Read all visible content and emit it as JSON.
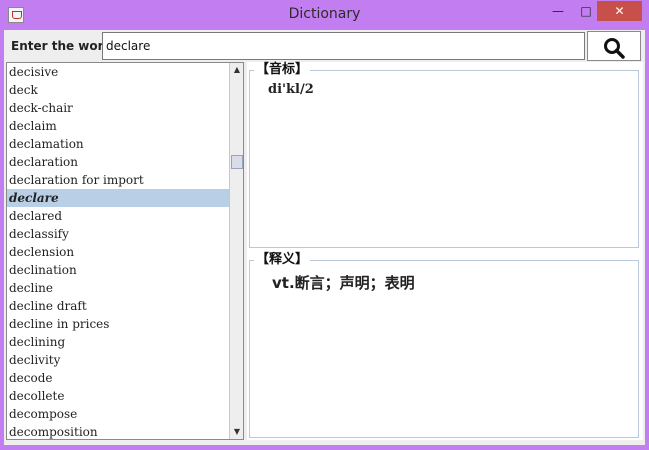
{
  "window": {
    "title": "Dictionary"
  },
  "titlebar": {
    "minimize": "—",
    "maximize": "□",
    "close": "✕"
  },
  "search": {
    "label": "Enter the word",
    "value": "declare"
  },
  "word_list": {
    "items": [
      "decisive",
      "deck",
      "deck-chair",
      "declaim",
      "declamation",
      "declaration",
      "declaration for import",
      "declare",
      "declared",
      "declassify",
      "declension",
      "declination",
      "decline",
      "decline draft",
      "decline in prices",
      "declining",
      "declivity",
      "decode",
      "decollete",
      "decompose",
      "decomposition"
    ],
    "selected": "declare"
  },
  "phonetic": {
    "title": "【音标】",
    "text": "di'kl/2"
  },
  "definition": {
    "title": "【释义】",
    "text": "vt.断言；声明；表明"
  },
  "icons": {
    "search": "search-icon",
    "app": "java-icon",
    "scroll_up": "arrow-up-icon",
    "scroll_down": "arrow-down-icon"
  }
}
